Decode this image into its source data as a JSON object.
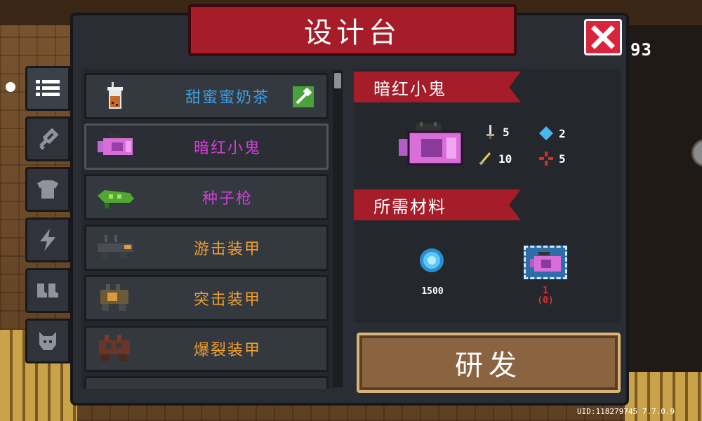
{
  "title": "设计台",
  "corner_number": "93",
  "uid_text": "UID:118279745 7.7.0.9",
  "tabs": [
    {
      "icon": "list-icon",
      "active": true
    },
    {
      "icon": "weapon-icon",
      "active": false
    },
    {
      "icon": "armor-icon",
      "active": false
    },
    {
      "icon": "lightning-icon",
      "active": false
    },
    {
      "icon": "boots-icon",
      "active": false
    },
    {
      "icon": "pet-icon",
      "active": false
    }
  ],
  "items": [
    {
      "name": "甜蜜蜜奶茶",
      "color": "#3aa0e8",
      "icon": "milk-tea-icon",
      "badge": "hammer-icon"
    },
    {
      "name": "暗红小鬼",
      "color": "#d23ed8",
      "icon": "dark-red-imp-gun-icon"
    },
    {
      "name": "种子枪",
      "color": "#d23ed8",
      "icon": "seed-gun-icon"
    },
    {
      "name": "游击装甲",
      "color": "#f0a030",
      "icon": "guerrilla-armor-icon"
    },
    {
      "name": "突击装甲",
      "color": "#f0a030",
      "icon": "assault-armor-icon"
    },
    {
      "name": "爆裂装甲",
      "color": "#f0a030",
      "icon": "burst-armor-icon"
    }
  ],
  "detail": {
    "item_name": "暗红小鬼",
    "stats": {
      "damage": "5",
      "energy": "2",
      "crit": "10",
      "spread": "5"
    },
    "materials_heading": "所需材料",
    "materials": [
      {
        "icon": "blue-gem-icon",
        "amount": "1500",
        "color": "#ffffff"
      },
      {
        "icon": "dark-red-imp-gun-icon",
        "amount": "1",
        "owned": "(0)",
        "color": "#e03030"
      }
    ]
  },
  "research_button": "研发",
  "colors": {
    "panel": "#2a2d33",
    "banner": "#a61c28",
    "button": "#8a6340"
  }
}
